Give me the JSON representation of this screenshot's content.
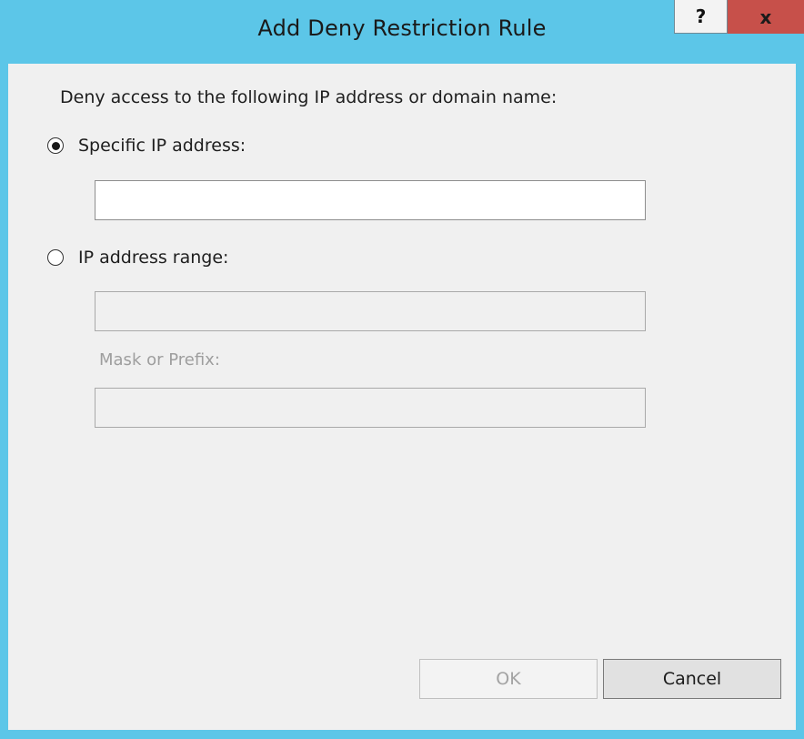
{
  "window": {
    "title": "Add Deny Restriction Rule",
    "help_glyph": "?",
    "close_glyph": "x"
  },
  "form": {
    "prompt": "Deny access to the following IP address or domain name:",
    "options": [
      {
        "label": "Specific IP address:",
        "selected": true
      },
      {
        "label": "IP address range:",
        "selected": false
      }
    ],
    "specific_ip_value": "",
    "range_ip_value": "",
    "mask_label": "Mask or Prefix:",
    "mask_value": ""
  },
  "buttons": {
    "ok_label": "OK",
    "ok_enabled": false,
    "cancel_label": "Cancel"
  },
  "colors": {
    "titlebar": "#5cc6e8",
    "close_button": "#c7504a",
    "client_background": "#f0f0f0"
  }
}
